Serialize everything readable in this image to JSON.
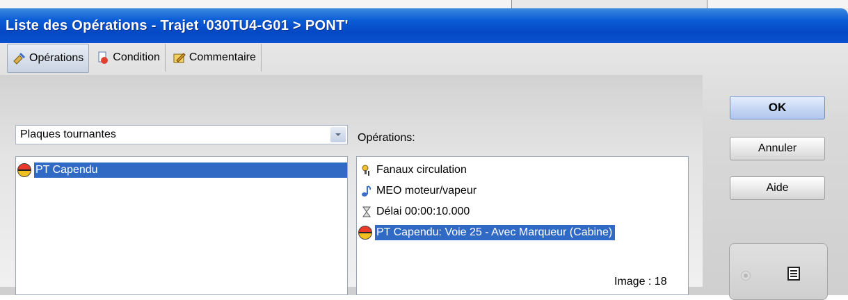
{
  "window": {
    "title": "Liste des Opérations - Trajet '030TU4-G01 > PONT'"
  },
  "tabs": [
    {
      "label": "Opérations",
      "icon": "wrench-operations-icon"
    },
    {
      "label": "Condition",
      "icon": "condition-icon"
    },
    {
      "label": "Commentaire",
      "icon": "comment-icon"
    }
  ],
  "left": {
    "combo_value": "Plaques tournantes",
    "items": [
      {
        "label": "PT Capendu",
        "icon": "turntable-icon",
        "selected": true
      }
    ]
  },
  "right": {
    "label": "Opérations:",
    "items": [
      {
        "label": "Fanaux circulation",
        "icon": "lights-icon"
      },
      {
        "label": "MEO moteur/vapeur",
        "icon": "music-note-icon"
      },
      {
        "label": "Délai 00:00:10.000",
        "icon": "hourglass-icon"
      },
      {
        "label": "PT Capendu: Voie 25 - Avec Marqueur (Cabine)",
        "icon": "turntable-icon",
        "selected": true
      }
    ],
    "image_count": "Image : 18"
  },
  "buttons": {
    "ok": "OK",
    "cancel": "Annuler",
    "help": "Aide"
  },
  "colors": {
    "titlebar": "#0a5bd6",
    "selection": "#316ac5"
  }
}
